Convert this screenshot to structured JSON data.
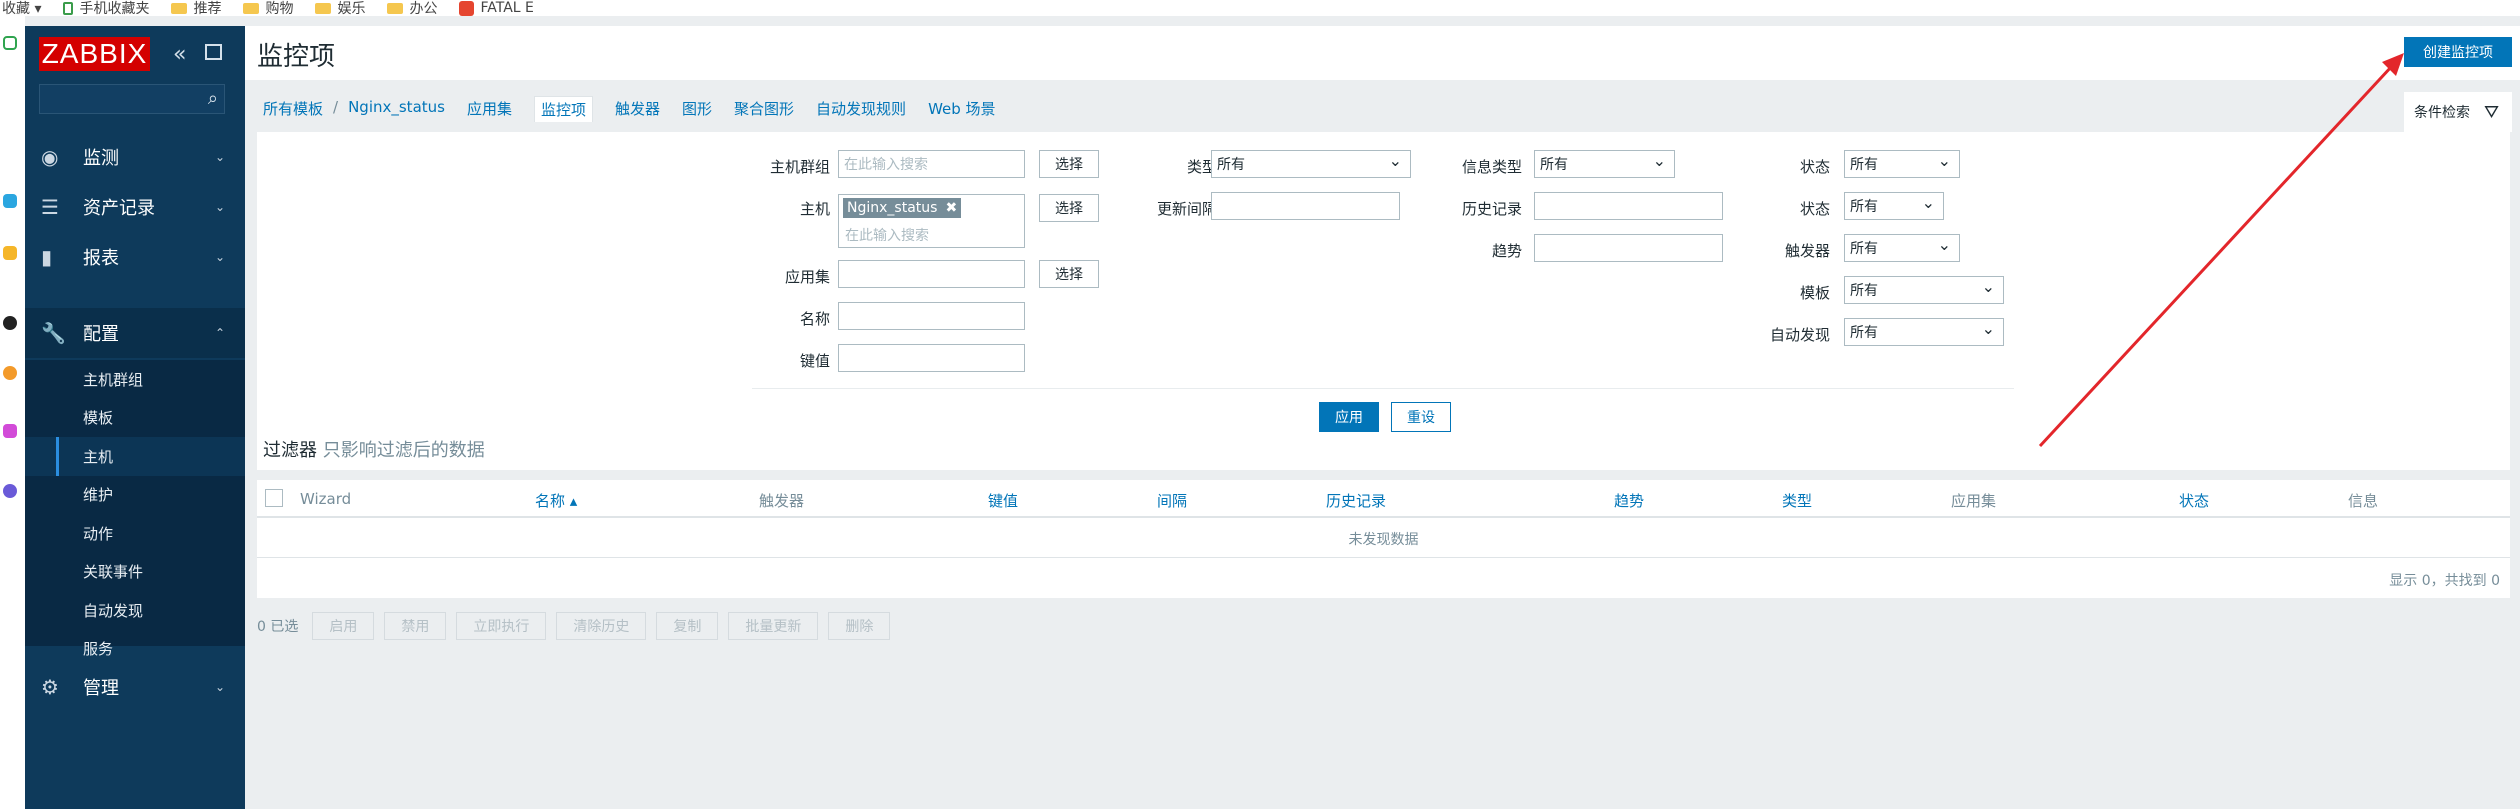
{
  "bookmarks": {
    "items": [
      {
        "label": "收藏 ▾",
        "icon": "none"
      },
      {
        "label": "手机收藏夹",
        "icon": "phone-icon"
      },
      {
        "label": "推荐",
        "icon": "folder-icon"
      },
      {
        "label": "购物",
        "icon": "folder-icon"
      },
      {
        "label": "娱乐",
        "icon": "folder-icon"
      },
      {
        "label": "办公",
        "icon": "folder-icon"
      },
      {
        "label": "FATAL E",
        "icon": "fatal-icon"
      }
    ]
  },
  "sidebar": {
    "logo": "ZABBIX",
    "collapse_icon": "«",
    "search_icon": "⌕",
    "menu": [
      {
        "label": "监测",
        "icon": "◉",
        "chevron": "⌄"
      },
      {
        "label": "资产记录",
        "icon": "☰",
        "chevron": "⌄"
      },
      {
        "label": "报表",
        "icon": "▮",
        "chevron": "⌄"
      },
      {
        "label": "配置",
        "icon": "🔧",
        "chevron": "⌃"
      },
      {
        "label": "管理",
        "icon": "⚙",
        "chevron": "⌄"
      }
    ],
    "submenu": [
      "主机群组",
      "模板",
      "主机",
      "维护",
      "动作",
      "关联事件",
      "自动发现",
      "服务"
    ]
  },
  "header": {
    "title": "监控项",
    "create_button": "创建监控项"
  },
  "nav": {
    "tabs": [
      "所有模板",
      "/",
      "Nginx_status",
      "应用集",
      "监控项",
      "触发器",
      "图形",
      "聚合图形",
      "自动发现规则",
      "Web 场景"
    ],
    "filter_tab": "条件检索",
    "filter_icon": "⛛"
  },
  "filter": {
    "host_group_label": "主机群组",
    "host_group_placeholder": "在此输入搜索",
    "select_label": "选择",
    "host_label": "主机",
    "host_chip": "Nginx_status",
    "host_chip_remove": "✖",
    "host_placeholder": "在此输入搜索",
    "app_label": "应用集",
    "name_label": "名称",
    "key_label": "键值",
    "type_label": "类型",
    "type_value": "所有",
    "interval_label": "更新间隔",
    "info_type_label": "信息类型",
    "info_type_value": "所有",
    "history_label": "历史记录",
    "trend_label": "趋势",
    "status1_label": "状态",
    "status1_value": "所有",
    "status2_label": "状态",
    "status2_value": "所有",
    "trigger_label": "触发器",
    "trigger_value": "所有",
    "template_label": "模板",
    "template_value": "所有",
    "discovery_label": "自动发现",
    "discovery_value": "所有",
    "apply": "应用",
    "reset": "重设",
    "note_main": "过滤器",
    "note_sub": "只影响过滤后的数据"
  },
  "table": {
    "columns": [
      "Wizard",
      "名称 ▴",
      "触发器",
      "键值",
      "间隔",
      "历史记录",
      "趋势",
      "类型",
      "应用集",
      "状态",
      "信息"
    ],
    "empty_text": "未发现数据",
    "pager": "显示 0，共找到 0"
  },
  "actions": {
    "selected": "0 已选",
    "buttons": [
      "启用",
      "禁用",
      "立即执行",
      "清除历史",
      "复制",
      "批量更新",
      "删除"
    ]
  },
  "colors": {
    "sidebar_bg": "#0e3a5b",
    "accent": "#0275b8",
    "logo_red": "#d40000",
    "arrow_red": "#e3262b"
  }
}
